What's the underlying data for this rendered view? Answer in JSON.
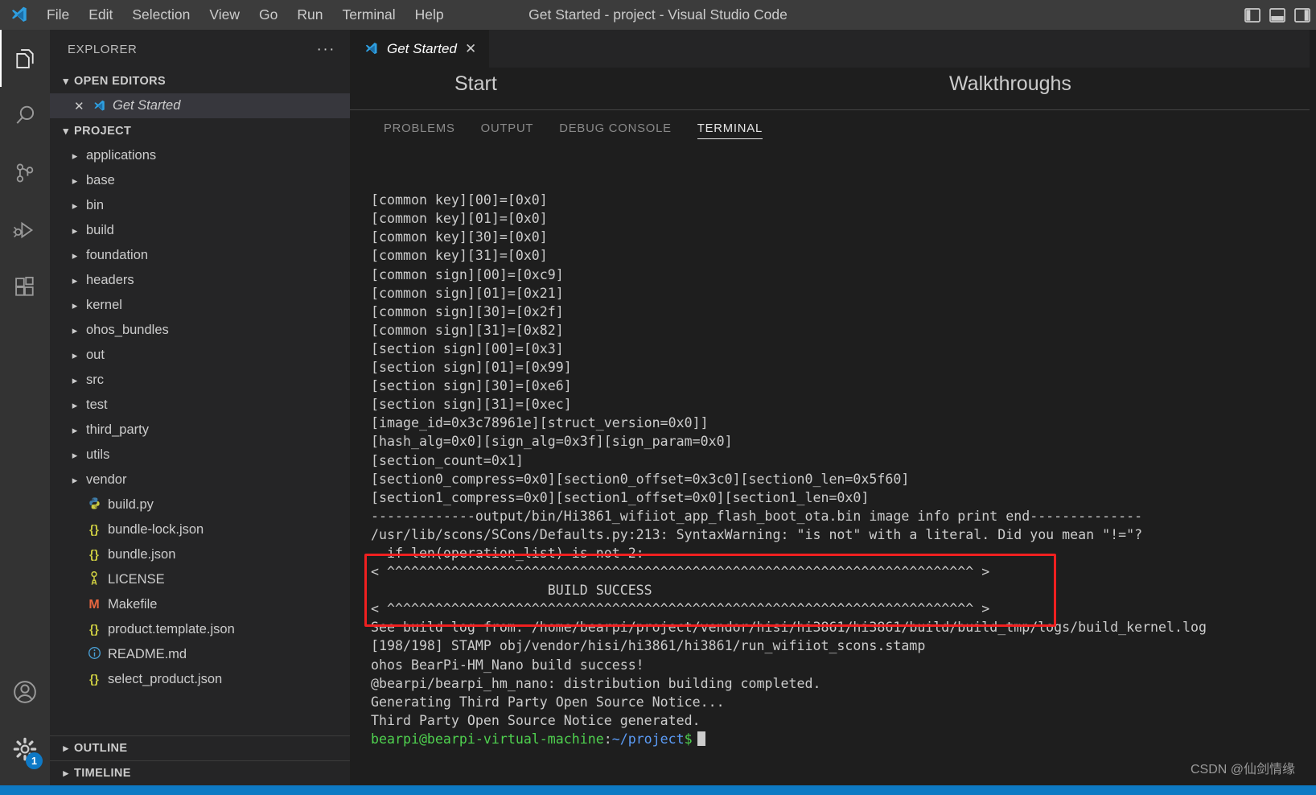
{
  "window": {
    "title": "Get Started - project - Visual Studio Code",
    "controls": [
      {
        "name": "toggle-primary-sidebar",
        "glyph": "panel-left"
      },
      {
        "name": "toggle-panel",
        "glyph": "panel-bottom"
      },
      {
        "name": "toggle-secondary-sidebar",
        "glyph": "panel-right"
      }
    ]
  },
  "menubar": {
    "items": [
      "File",
      "Edit",
      "Selection",
      "View",
      "Go",
      "Run",
      "Terminal",
      "Help"
    ]
  },
  "activitybar": {
    "items": [
      {
        "name": "explorer",
        "icon": "files-icon",
        "active": true
      },
      {
        "name": "search",
        "icon": "search-icon",
        "active": false
      },
      {
        "name": "source-control",
        "icon": "source-control-icon",
        "active": false
      },
      {
        "name": "run-and-debug",
        "icon": "run-debug-icon",
        "active": false
      },
      {
        "name": "extensions",
        "icon": "extensions-icon",
        "active": false
      }
    ],
    "bottom": [
      {
        "name": "accounts",
        "icon": "account-icon"
      },
      {
        "name": "manage",
        "icon": "gear-icon",
        "badge": "1"
      }
    ]
  },
  "sidebar": {
    "title": "EXPLORER",
    "more_actions": "···",
    "open_editors": {
      "label": "OPEN EDITORS",
      "expanded": true,
      "items": [
        {
          "label": "Get Started",
          "close": "✕",
          "icon": "vscode-icon",
          "active": true
        }
      ]
    },
    "project": {
      "label": "PROJECT",
      "expanded": true,
      "items": [
        {
          "label": "applications",
          "type": "folder"
        },
        {
          "label": "base",
          "type": "folder"
        },
        {
          "label": "bin",
          "type": "folder"
        },
        {
          "label": "build",
          "type": "folder"
        },
        {
          "label": "foundation",
          "type": "folder"
        },
        {
          "label": "headers",
          "type": "folder"
        },
        {
          "label": "kernel",
          "type": "folder"
        },
        {
          "label": "ohos_bundles",
          "type": "folder"
        },
        {
          "label": "out",
          "type": "folder"
        },
        {
          "label": "src",
          "type": "folder"
        },
        {
          "label": "test",
          "type": "folder"
        },
        {
          "label": "third_party",
          "type": "folder"
        },
        {
          "label": "utils",
          "type": "folder"
        },
        {
          "label": "vendor",
          "type": "folder"
        },
        {
          "label": "build.py",
          "type": "file",
          "icon": "python-icon"
        },
        {
          "label": "bundle-lock.json",
          "type": "file",
          "icon": "json-icon"
        },
        {
          "label": "bundle.json",
          "type": "file",
          "icon": "json-icon"
        },
        {
          "label": "LICENSE",
          "type": "file",
          "icon": "license-icon"
        },
        {
          "label": "Makefile",
          "type": "file",
          "icon": "makefile-icon"
        },
        {
          "label": "product.template.json",
          "type": "file",
          "icon": "json-icon"
        },
        {
          "label": "README.md",
          "type": "file",
          "icon": "readme-icon"
        },
        {
          "label": "select_product.json",
          "type": "file",
          "icon": "json-icon"
        }
      ]
    },
    "footer": [
      {
        "label": "OUTLINE",
        "expanded": false
      },
      {
        "label": "TIMELINE",
        "expanded": false
      }
    ]
  },
  "editor": {
    "tabs": [
      {
        "label": "Get Started",
        "close": "✕",
        "active": true
      }
    ],
    "get_started": {
      "start_heading": "Start",
      "walkthroughs_heading": "Walkthroughs"
    }
  },
  "panel": {
    "tabs": [
      {
        "label": "PROBLEMS",
        "active": false
      },
      {
        "label": "OUTPUT",
        "active": false
      },
      {
        "label": "DEBUG CONSOLE",
        "active": false
      },
      {
        "label": "TERMINAL",
        "active": true
      }
    ]
  },
  "terminal": {
    "lines": [
      "[common key][00]=[0x0]",
      "[common key][01]=[0x0]",
      "[common key][30]=[0x0]",
      "[common key][31]=[0x0]",
      "[common sign][00]=[0xc9]",
      "[common sign][01]=[0x21]",
      "[common sign][30]=[0x2f]",
      "[common sign][31]=[0x82]",
      "[section sign][00]=[0x3]",
      "[section sign][01]=[0x99]",
      "[section sign][30]=[0xe6]",
      "[section sign][31]=[0xec]",
      "[image_id=0x3c78961e][struct_version=0x0]]",
      "[hash_alg=0x0][sign_alg=0x3f][sign_param=0x0]",
      "[section_count=0x1]",
      "[section0_compress=0x0][section0_offset=0x3c0][section0_len=0x5f60]",
      "[section1_compress=0x0][section1_offset=0x0][section1_len=0x0]",
      "-------------output/bin/Hi3861_wifiiot_app_flash_boot_ota.bin image info print end--------------",
      "/usr/lib/scons/SCons/Defaults.py:213: SyntaxWarning: \"is not\" with a literal. Did you mean \"!=\"?",
      "  if len(operation_list) is not 2:",
      ""
    ],
    "success_block": {
      "top_rule": "< ^^^^^^^^^^^^^^^^^^^^^^^^^^^^^^^^^^^^^^^^^^^^^^^^^^^^^^^^^^^^^^^^^^^^^^^^^ >",
      "message": "BUILD SUCCESS",
      "bottom_rule": "< ^^^^^^^^^^^^^^^^^^^^^^^^^^^^^^^^^^^^^^^^^^^^^^^^^^^^^^^^^^^^^^^^^^^^^^^^^ >",
      "highlight_color": "#f02020"
    },
    "after_lines": [
      "",
      "See build log from: /home/bearpi/project/vendor/hisi/hi3861/hi3861/build/build_tmp/logs/build_kernel.log",
      "[198/198] STAMP obj/vendor/hisi/hi3861/hi3861/run_wifiiot_scons.stamp",
      "ohos BearPi-HM_Nano build success!",
      "@bearpi/bearpi_hm_nano: distribution building completed.",
      "Generating Third Party Open Source Notice...",
      "Third Party Open Source Notice generated."
    ],
    "prompt": {
      "user_host": "bearpi@bearpi-virtual-machine",
      "separator": ":",
      "path": "~/project",
      "sigil": "$"
    }
  },
  "watermark": "CSDN @仙剑情缘",
  "colors": {
    "titlebar_bg": "#3c3c3c",
    "activitybar_bg": "#333333",
    "sidebar_bg": "#252526",
    "editor_bg": "#1e1e1e",
    "statusbar_bg": "#0e7ac4",
    "accent": "#0e79c6",
    "prompt_green": "#4fd14f",
    "prompt_blue": "#5b9bf5",
    "highlight_red": "#f02020"
  }
}
